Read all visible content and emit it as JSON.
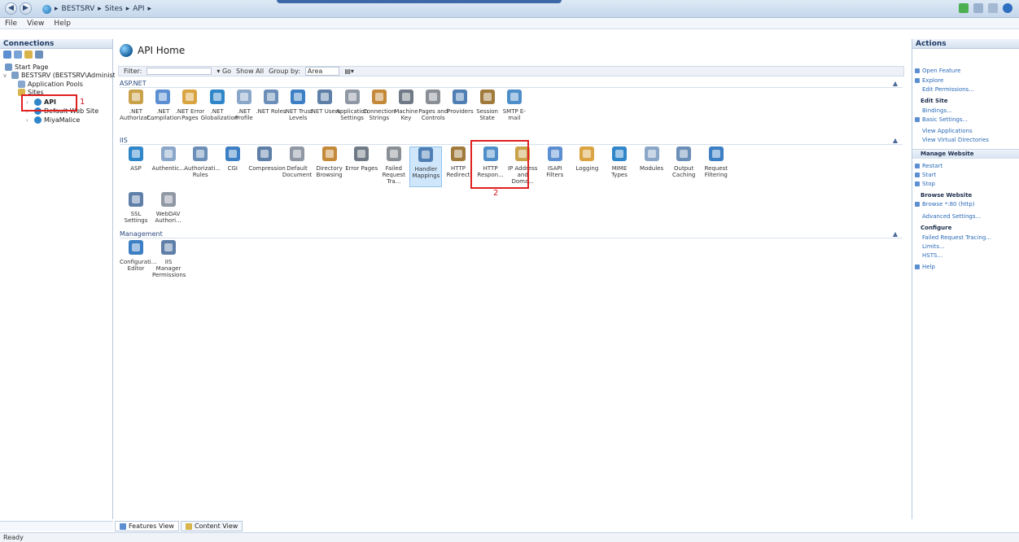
{
  "window": {
    "breadcrumb": [
      "BESTSRV",
      "Sites",
      "API"
    ],
    "menu": [
      "File",
      "View",
      "Help"
    ]
  },
  "connections": {
    "header": "Connections",
    "tree": [
      {
        "label": "Start Page"
      },
      {
        "label": "BESTSRV (BESTSRV\\Administr"
      },
      {
        "label": "Application Pools"
      },
      {
        "label": "Sites"
      },
      {
        "label": "API"
      },
      {
        "label": "Default Web Site"
      },
      {
        "label": "MiyaMalice"
      }
    ],
    "annotation": "1"
  },
  "center": {
    "title": "API Home",
    "filter_label": "Filter:",
    "go_label": "Go",
    "show_all_label": "Show All",
    "group_by_label": "Group by:",
    "group_by_value": "Area",
    "sections": [
      {
        "title": "ASP.NET",
        "items": [
          ".NET Authorizat...",
          ".NET Compilation",
          ".NET Error Pages",
          ".NET Globalization",
          ".NET Profile",
          ".NET Roles",
          ".NET Trust Levels",
          ".NET Users",
          "Application Settings",
          "Connection Strings",
          "Machine Key",
          "Pages and Controls",
          "Providers",
          "Session State",
          "SMTP E-mail"
        ]
      },
      {
        "title": "IIS",
        "items": [
          "ASP",
          "Authentic...",
          "Authorizati... Rules",
          "CGI",
          "Compression",
          "Default Document",
          "Directory Browsing",
          "Error Pages",
          "Failed Request Tra...",
          "Handler Mappings",
          "HTTP Redirect",
          "HTTP Respon...",
          "IP Address and Doma...",
          "ISAPI Filters",
          "Logging",
          "MIME Types",
          "Modules",
          "Output Caching",
          "Request Filtering",
          "SSL Settings",
          "WebDAV Authori..."
        ]
      },
      {
        "title": "Management",
        "items": [
          "Configurati... Editor",
          "IIS Manager Permissions"
        ]
      }
    ],
    "annotation": "2"
  },
  "view_tabs": [
    "Features View",
    "Content View"
  ],
  "actions": {
    "header": "Actions",
    "items": [
      "Open Feature",
      "Explore",
      "Edit Permissions...",
      "Edit Site",
      "Bindings...",
      "Basic Settings...",
      "View Applications",
      "View Virtual Directories",
      "Manage Website",
      "Restart",
      "Start",
      "Stop",
      "Browse Website",
      "Browse *:80 (http)",
      "Advanced Settings...",
      "Configure",
      "Failed Request Tracing...",
      "Limits...",
      "HSTS...",
      "Help"
    ]
  },
  "status": "Ready",
  "colors": {
    "highlight_red": "#e02020",
    "link_blue": "#2a6ab8",
    "selection_blue": "#cfe6fb"
  }
}
